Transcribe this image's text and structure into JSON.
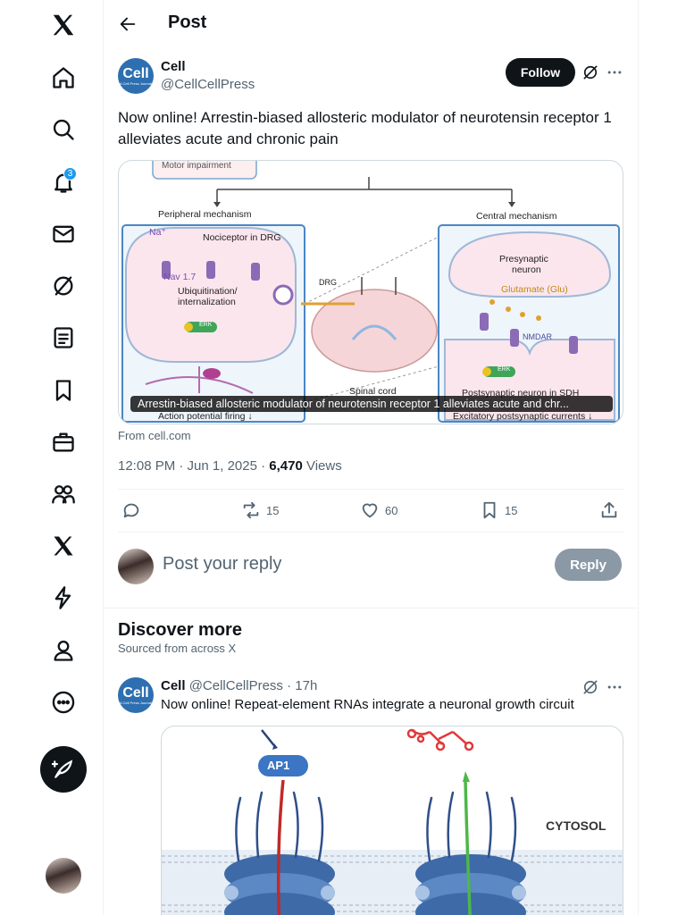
{
  "nav": {
    "notifications_badge": "3"
  },
  "header": {
    "title": "Post"
  },
  "post": {
    "author_name": "Cell",
    "author_handle": "@CellCellPress",
    "avatar_text": "Cell",
    "avatar_subtext": "A Cell Press Journal",
    "follow_label": "Follow",
    "text": "Now online!  Arrestin-biased allosteric modulator of neurotensin receptor 1 alleviates acute and chronic pain",
    "figure": {
      "labels": {
        "top": "Motor impairment",
        "peripheral": "Peripheral mechanism",
        "central": "Central mechanism",
        "nociceptor": "Nociceptor in DRG",
        "na": "Na⁺",
        "nav": "Nav 1.7",
        "ubiq": "Ubiquitination/",
        "intern": "internalization",
        "erk": "ERK",
        "drg": "DRG",
        "spinal": "Spinal cord",
        "presyn": "Presynaptic",
        "neuron": "neuron",
        "glu": "Glutamate (Glu)",
        "nmdar": "NMDAR",
        "postsyn": "Postsynaptic neuron in SDH",
        "apfiring": "Action potential firing ↓",
        "epsc": "Excitatory postsynaptic currents ↓"
      },
      "caption": "Arrestin-biased allosteric modulator of neurotensin receptor 1 alleviates acute and chr..."
    },
    "source": "From cell.com",
    "time": "12:08 PM · Jun 1, 2025 · ",
    "views_count": "6,470",
    "views_label": " Views",
    "retweets": "15",
    "likes": "60",
    "bookmarks": "15"
  },
  "reply": {
    "placeholder": "Post your reply",
    "button": "Reply"
  },
  "discover": {
    "title": "Discover more",
    "subtitle": "Sourced from across X",
    "post": {
      "author_name": "Cell",
      "author_handle": "@CellCellPress",
      "time": " · 17h",
      "text": "Now online!  Repeat-element RNAs integrate a neuronal growth circuit",
      "figure_labels": {
        "ap1": "AP1",
        "cytosol": "CYTOSOL"
      }
    }
  },
  "colors": {
    "accent": "#1d9bf0",
    "text": "#0f1419",
    "muted": "#536471"
  }
}
